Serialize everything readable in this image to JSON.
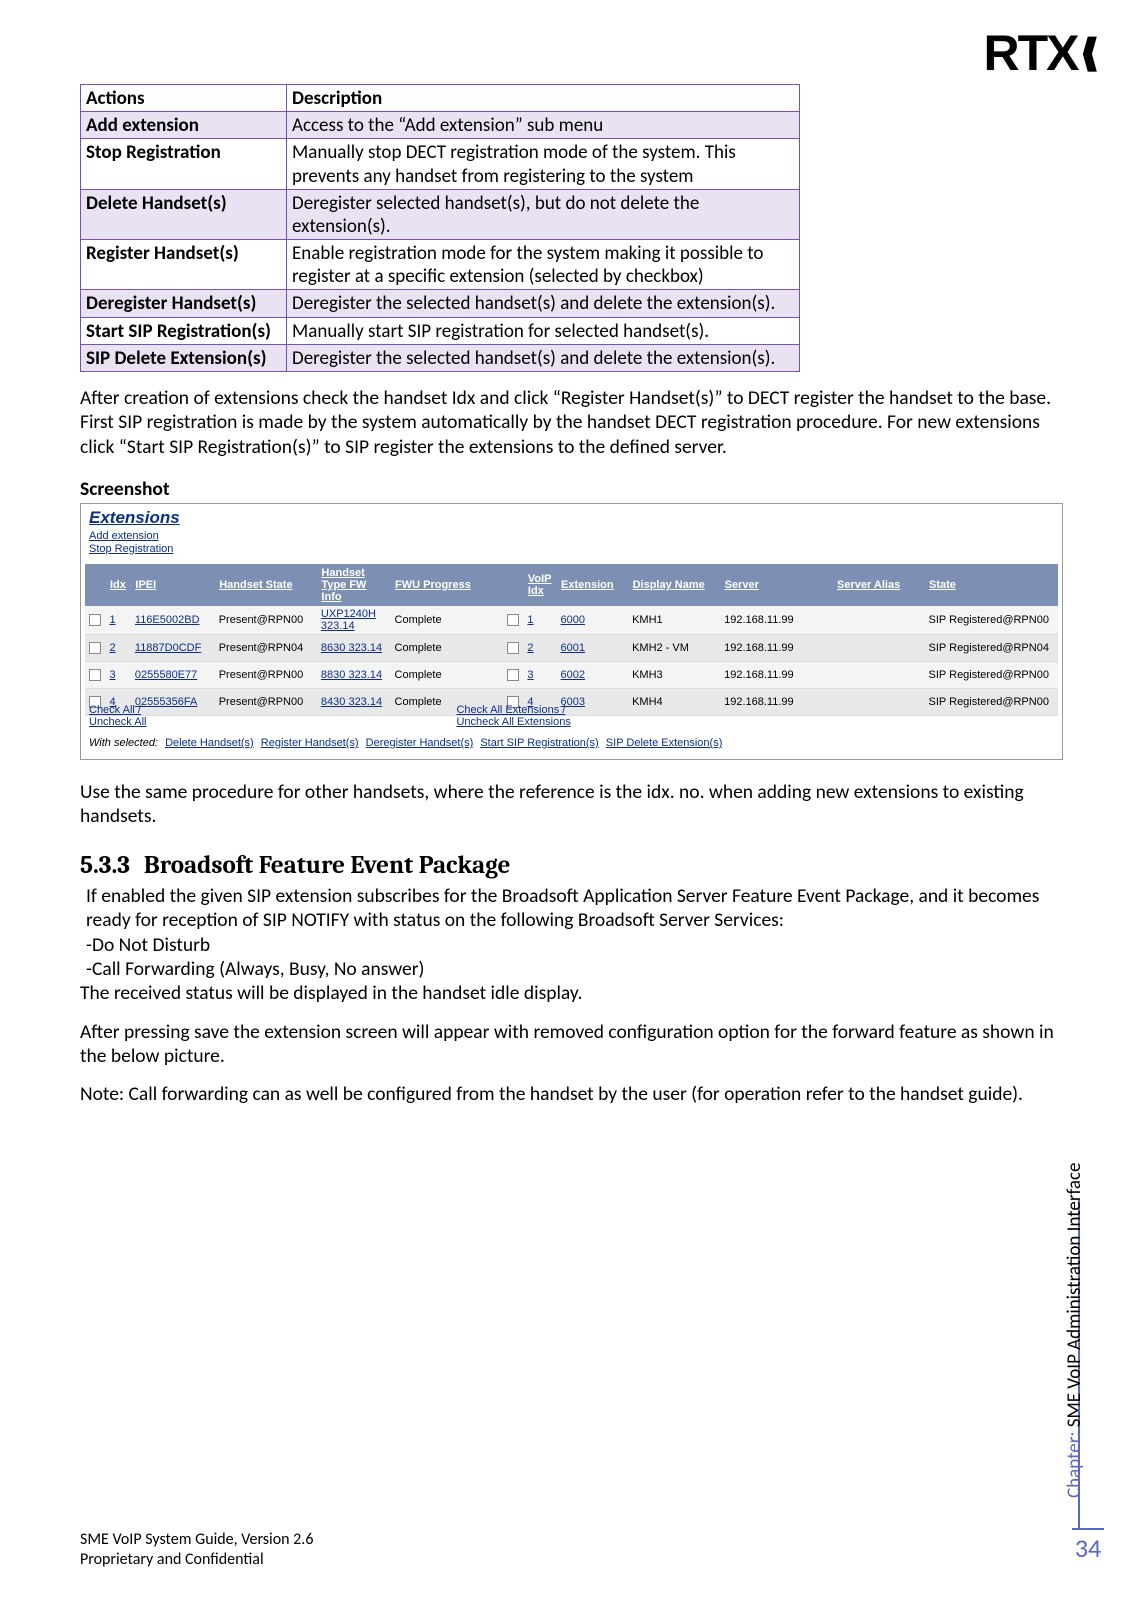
{
  "logo": {
    "text": "RTX",
    "arrows": "⟨⟨⟨"
  },
  "actions_table": {
    "header": {
      "actions": "Actions",
      "description": "Description"
    },
    "rows": [
      {
        "shade": true,
        "a": "Add extension",
        "d": "Access to the “Add extension” sub menu"
      },
      {
        "shade": false,
        "a": "Stop Registration",
        "d": "Manually stop DECT registration mode of the system. This prevents any handset from registering to the system"
      },
      {
        "shade": true,
        "a": "Delete Handset(s)",
        "d": "Deregister selected handset(s), but do not delete the extension(s)."
      },
      {
        "shade": false,
        "a": "Register Handset(s)",
        "d": "Enable registration mode for the system making it possible to register at a specific extension (selected by checkbox)"
      },
      {
        "shade": true,
        "a": "Deregister Handset(s)",
        "d": "Deregister the selected handset(s) and delete the extension(s)."
      },
      {
        "shade": false,
        "a": "Start SIP Registration(s)",
        "d": "Manually start SIP registration for selected handset(s)."
      },
      {
        "shade": true,
        "a": "SIP Delete Extension(s)",
        "d": "Deregister the selected handset(s) and delete the extension(s)."
      }
    ]
  },
  "para1": "After creation of extensions check the handset Idx and click “Register Handset(s)” to DECT register the handset to the base. First SIP registration is made by the system automatically by the handset DECT registration procedure. For new extensions click “Start SIP Registration(s)” to SIP register the extensions to the defined server.",
  "screenshot_label": "Screenshot",
  "shot": {
    "title": "Extensions",
    "top_links": [
      "Add extension",
      "Stop Registration"
    ],
    "headers": {
      "idx": "Idx",
      "ipei": "IPEI",
      "hs": "Handset State",
      "ht": "Handset Type FW Info",
      "fwu": "FWU Progress",
      "vidx": "VoIP Idx",
      "ext": "Extension",
      "dn": "Display Name",
      "srv": "Server",
      "sa": "Server Alias",
      "st": "State"
    },
    "rows": [
      {
        "idx": "1",
        "ipei": "116E5002BD",
        "hs": "Present@RPN00",
        "ht": "UXP1240H 323.14",
        "fwu": "Complete",
        "vidx": "1",
        "ext": "6000",
        "dn": "KMH1",
        "srv": "192.168.11.99",
        "sa": "",
        "st": "SIP Registered@RPN00"
      },
      {
        "idx": "2",
        "ipei": "11887D0CDF",
        "hs": "Present@RPN04",
        "ht": "8630 323.14",
        "fwu": "Complete",
        "vidx": "2",
        "ext": "6001",
        "dn": "KMH2 - VM",
        "srv": "192.168.11.99",
        "sa": "",
        "st": "SIP Registered@RPN04"
      },
      {
        "idx": "3",
        "ipei": "0255580E77",
        "hs": "Present@RPN00",
        "ht": "8830 323.14",
        "fwu": "Complete",
        "vidx": "3",
        "ext": "6002",
        "dn": "KMH3",
        "srv": "192.168.11.99",
        "sa": "",
        "st": "SIP Registered@RPN00"
      },
      {
        "idx": "4",
        "ipei": "02555356FA",
        "hs": "Present@RPN00",
        "ht": "8430 323.14",
        "fwu": "Complete",
        "vidx": "4",
        "ext": "6003",
        "dn": "KMH4",
        "srv": "192.168.11.99",
        "sa": "",
        "st": "SIP Registered@RPN00"
      }
    ],
    "bottom_left": [
      "Check All /",
      "Uncheck All"
    ],
    "bottom_mid": [
      "Check All Extensions /",
      "Uncheck All Extensions"
    ],
    "with_selected_label": "With selected:",
    "with_selected_links": [
      "Delete Handset(s)",
      "Register Handset(s)",
      "Deregister Handset(s)",
      "Start SIP Registration(s)",
      "SIP Delete Extension(s)"
    ]
  },
  "para2": "Use the same procedure for other handsets, where the reference is the idx. no. when adding new extensions to existing handsets.",
  "section": {
    "num": "5.3.3",
    "title": "Broadsoft Feature Event Package"
  },
  "para3_lines": [
    "If enabled the given SIP extension subscribes for the Broadsoft Application Server Feature Event Package, and it becomes ready for reception of SIP NOTIFY with status on the following Broadsoft Server Services:",
    "-Do Not Disturb",
    "-Call Forwarding (Always, Busy, No answer)"
  ],
  "para4": "The received status will be displayed in the handset idle display.",
  "para5": "After pressing save the extension screen will appear with removed configuration option for the forward feature as shown in the below picture.",
  "para6": "Note: Call forwarding can as well be configured from the handset by the user (for operation refer to the handset guide).",
  "side": {
    "chapter_label": "Chapter:",
    "chapter_text": " SME VoIP Administration Interface"
  },
  "page_number": "34",
  "footer": {
    "l1": "SME VoIP System Guide, Version 2.6",
    "l2": "Proprietary and Confidential"
  }
}
